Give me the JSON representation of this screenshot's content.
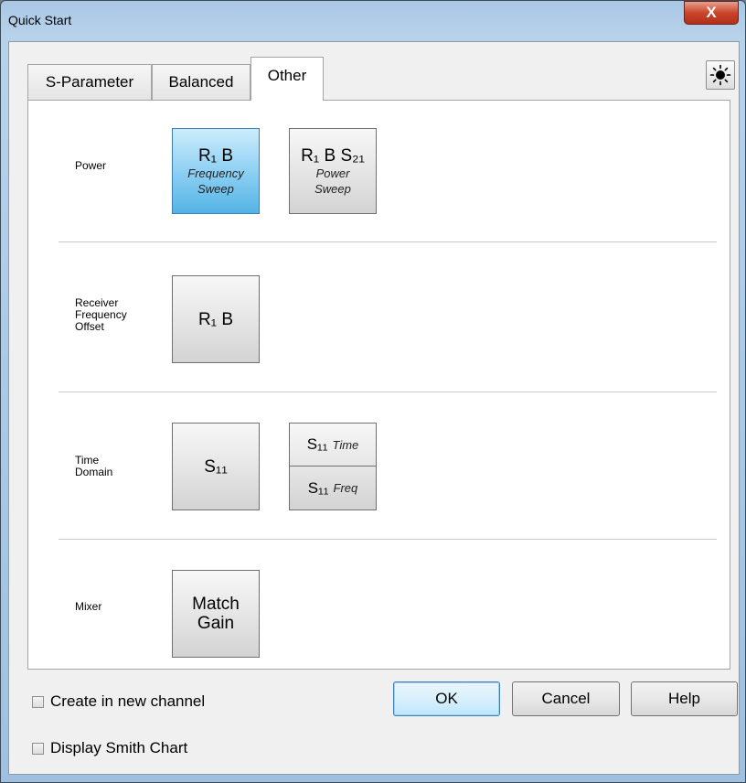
{
  "window": {
    "title": "Quick Start",
    "close_glyph": "X"
  },
  "tabs": [
    {
      "label": "S-Parameter",
      "active": false
    },
    {
      "label": "Balanced",
      "active": false
    },
    {
      "label": "Other",
      "active": true
    }
  ],
  "toolbar": {
    "brightness_icon": "sun-icon"
  },
  "sections": {
    "power": {
      "label_lines": [
        "Power"
      ],
      "buttons": [
        {
          "line1": "R₁  B",
          "line2": "Frequency",
          "line3": "Sweep",
          "selected": true
        },
        {
          "line1": "R₁ B S₂₁",
          "line2": "Power",
          "line3": "Sweep",
          "selected": false
        }
      ]
    },
    "receiver": {
      "label_lines": [
        "Receiver",
        "Frequency",
        "Offset"
      ],
      "buttons": [
        {
          "line1": "R₁  B"
        }
      ]
    },
    "time_domain": {
      "label_lines": [
        "Time",
        "Domain"
      ],
      "buttons": [
        {
          "line1": "S₁₁"
        },
        {
          "top_main": "S₁₁",
          "top_sub": "Time",
          "bottom_main": "S₁₁",
          "bottom_sub": "Freq"
        }
      ]
    },
    "mixer": {
      "label_lines": [
        "Mixer"
      ],
      "buttons": [
        {
          "line1": "Match",
          "line2": "Gain"
        }
      ]
    }
  },
  "footer": {
    "create_new_channel": {
      "label": "Create in new channel",
      "checked": false
    },
    "display_smith_chart": {
      "label": "Display Smith Chart",
      "checked": false
    },
    "ok_label": "OK",
    "cancel_label": "Cancel",
    "help_label": "Help"
  },
  "colors": {
    "selected_button": "#8fd0f3",
    "close_button": "#c9452c",
    "title_bar": "#b8d2ea"
  }
}
